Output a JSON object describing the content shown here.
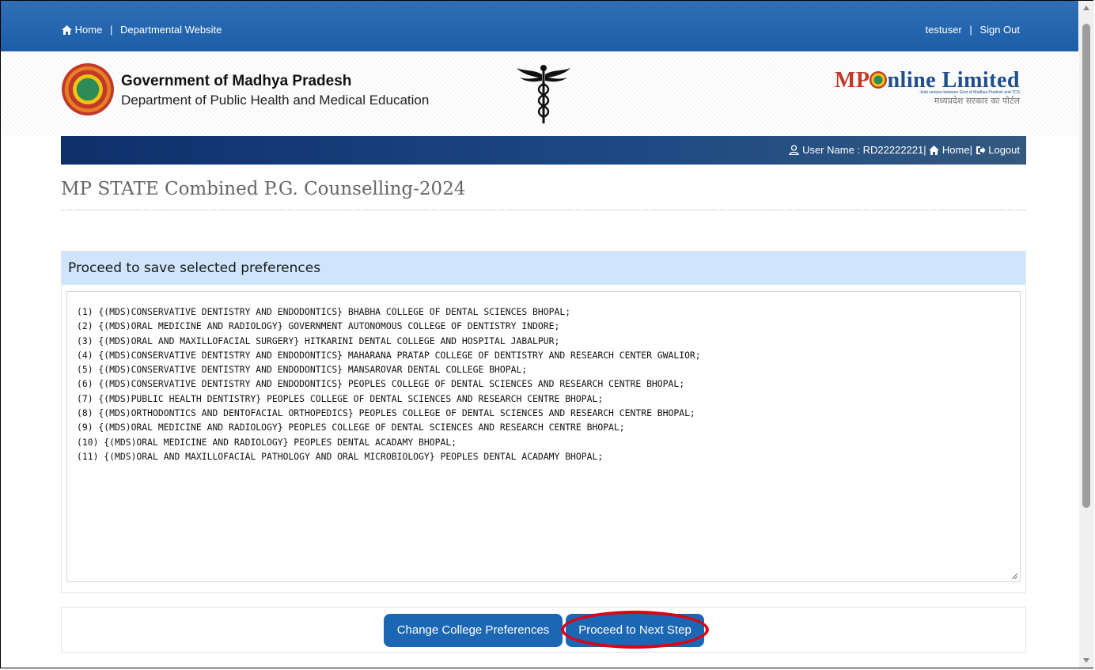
{
  "topbar": {
    "home": "Home",
    "departmental_website": "Departmental Website",
    "username": "testuser",
    "sign_out": "Sign Out",
    "separator": "|"
  },
  "header": {
    "gov_title": "Government of Madhya Pradesh",
    "gov_subtitle": "Department of Public Health and Medical Education",
    "brand_mp": "MP",
    "brand_nline": "nline",
    "brand_limited": "Limited",
    "brand_tagline": "Joint venture between Govt of Madhya Pradesh and TCS",
    "brand_hindi": "मध्यप्रदेश सरकार का पोर्टल",
    "emblem_icon": "mp-emblem-icon",
    "caduceus_icon": "caduceus-icon"
  },
  "navbar": {
    "user_label": "User Name : RD22222221",
    "home": "Home",
    "logout": "Logout",
    "separator": "|"
  },
  "page_title": "MP STATE Combined P.G. Counselling-2024",
  "panel": {
    "heading": "Proceed to save selected preferences",
    "preferences": [
      "(1) {(MDS)CONSERVATIVE DENTISTRY AND ENDODONTICS} BHABHA COLLEGE OF DENTAL SCIENCES BHOPAL;",
      "(2) {(MDS)ORAL MEDICINE AND RADIOLOGY} GOVERNMENT AUTONOMOUS COLLEGE OF DENTISTRY INDORE;",
      "(3) {(MDS)ORAL AND MAXILLOFACIAL SURGERY} HITKARINI DENTAL COLLEGE AND HOSPITAL JABALPUR;",
      "(4) {(MDS)CONSERVATIVE DENTISTRY AND ENDODONTICS} MAHARANA PRATAP COLLEGE OF DENTISTRY AND RESEARCH CENTER GWALIOR;",
      "(5) {(MDS)CONSERVATIVE DENTISTRY AND ENDODONTICS} MANSAROVAR DENTAL COLLEGE BHOPAL;",
      "(6) {(MDS)CONSERVATIVE DENTISTRY AND ENDODONTICS} PEOPLES COLLEGE OF DENTAL SCIENCES AND RESEARCH CENTRE BHOPAL;",
      "(7) {(MDS)PUBLIC HEALTH DENTISTRY} PEOPLES COLLEGE OF DENTAL SCIENCES AND RESEARCH CENTRE BHOPAL;",
      "(8) {(MDS)ORTHODONTICS AND DENTOFACIAL ORTHOPEDICS} PEOPLES COLLEGE OF DENTAL SCIENCES AND RESEARCH CENTRE BHOPAL;",
      "(9) {(MDS)ORAL MEDICINE AND RADIOLOGY} PEOPLES COLLEGE OF DENTAL SCIENCES AND RESEARCH CENTRE BHOPAL;",
      "(10) {(MDS)ORAL MEDICINE AND RADIOLOGY} PEOPLES DENTAL ACADAMY BHOPAL;",
      "(11) {(MDS)ORAL AND MAXILLOFACIAL PATHOLOGY AND ORAL MICROBIOLOGY} PEOPLES DENTAL ACADAMY BHOPAL;"
    ]
  },
  "buttons": {
    "change_preferences": "Change College Preferences",
    "proceed_next": "Proceed to Next Step"
  },
  "colors": {
    "topbar": "#1c5ea8",
    "button": "#1c67b3",
    "panel_head": "#cfe5fb",
    "highlight": "#e00012",
    "brand_red": "#c0392b",
    "brand_blue": "#1f4e8c"
  }
}
